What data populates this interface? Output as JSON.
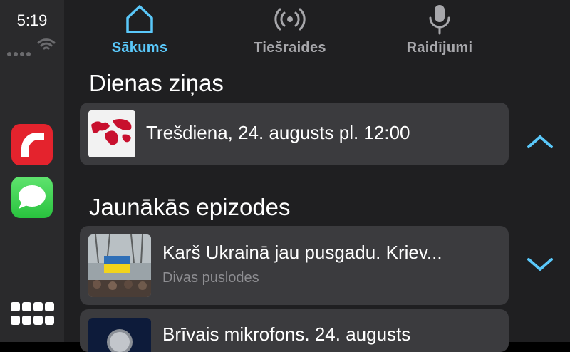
{
  "status": {
    "time": "5:19"
  },
  "sidebar": {
    "apps": [
      {
        "name": "Radio"
      },
      {
        "name": "Messages"
      }
    ]
  },
  "tabs": [
    {
      "label": "Sākums",
      "icon": "home-icon",
      "active": true
    },
    {
      "label": "Tiešraides",
      "icon": "broadcast-icon",
      "active": false
    },
    {
      "label": "Raidījumi",
      "icon": "microphone-icon",
      "active": false
    }
  ],
  "sections": {
    "daily": {
      "title": "Dienas ziņas",
      "item": {
        "text": "Trešdiena, 24. augusts pl. 12:00"
      }
    },
    "episodes": {
      "title": "Jaunākās epizodes",
      "items": [
        {
          "title": "Karš Ukrainā jau pusgadu. Kriev...",
          "subtitle": "Divas puslodes"
        },
        {
          "title": "Brīvais mikrofons. 24. augusts",
          "subtitle": ""
        }
      ]
    }
  },
  "colors": {
    "accent": "#5ac8fa",
    "sidebar_bg": "#2a2a2c",
    "main_bg": "#1f1f21",
    "card_bg": "#3b3b3e"
  }
}
